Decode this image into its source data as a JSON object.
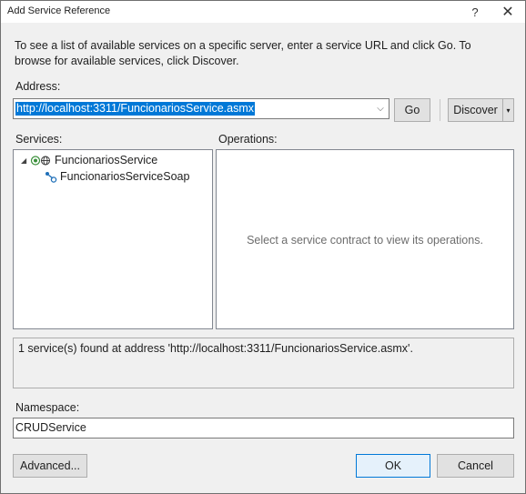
{
  "window": {
    "title": "Add Service Reference",
    "help_glyph": "?",
    "close_glyph": "✕"
  },
  "intro_text": "To see a list of available services on a specific server, enter a service URL and click Go. To browse for available services, click Discover.",
  "address": {
    "label": "Address:",
    "value": "http://localhost:3311/FuncionariosService.asmx",
    "dropdown_glyph": "⌵"
  },
  "buttons": {
    "go": "Go",
    "discover": "Discover",
    "discover_split_glyph": "▾",
    "advanced": "Advanced...",
    "ok": "OK",
    "cancel": "Cancel"
  },
  "services": {
    "label": "Services:",
    "tree": [
      {
        "label": "FuncionariosService",
        "expanded": true,
        "icon": "web-service-icon"
      },
      {
        "label": "FuncionariosServiceSoap",
        "icon": "service-contract-icon"
      }
    ]
  },
  "operations": {
    "label": "Operations:",
    "placeholder": "Select a service contract to view its operations."
  },
  "status": "1 service(s) found at address 'http://localhost:3311/FuncionariosService.asmx'.",
  "namespace": {
    "label": "Namespace:",
    "value": "CRUDService"
  },
  "colors": {
    "accent": "#0078d7",
    "dialog_bg": "#f0f0f0"
  }
}
